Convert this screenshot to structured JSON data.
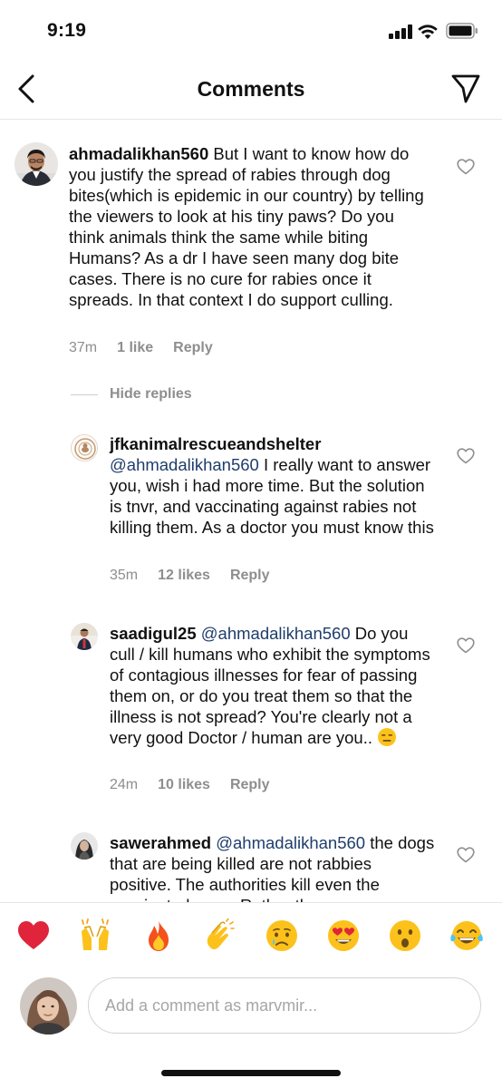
{
  "status_bar": {
    "time": "9:19"
  },
  "header": {
    "title": "Comments"
  },
  "comments": [
    {
      "username": "ahmadalikhan560",
      "mention": "",
      "text": "But I want to know how do you justify the spread of rabies through dog bites(which is epidemic in our country) by telling the viewers to look at his tiny paws? Do you think animals think the same while biting Humans? As a dr I have seen many dog bite cases. There is no cure for rabies once it spreads. In that context I do support culling.",
      "time": "37m",
      "likes": "1 like",
      "reply": "Reply"
    },
    {
      "username": "jfkanimalrescueandshelter",
      "mention": "@ahmadalikhan560",
      "text": "I really want to answer you, wish i had more time. But the solution is tnvr, and vaccinating against rabies not killing them. As a doctor you must know this",
      "time": "35m",
      "likes": "12 likes",
      "reply": "Reply"
    },
    {
      "username": "saadigul25",
      "mention": "@ahmadalikhan560",
      "text": "Do you cull / kill humans who exhibit the symptoms of contagious illnesses for fear of passing them on, or do you treat them so that the illness is not spread? You're clearly not a very good Doctor / human are you..",
      "time": "24m",
      "likes": "10 likes",
      "reply": "Reply"
    },
    {
      "username": "sawerahmed",
      "mention": "@ahmadalikhan560",
      "text": "the dogs that are being killed are not rabbies positive. The authorities kill even the vaccinated ones. Rather than",
      "time": "",
      "likes": "",
      "reply": ""
    }
  ],
  "hide_replies": "Hide replies",
  "emoji_bar": [
    "red-heart-emoji",
    "raising-hands-emoji",
    "fire-emoji",
    "clapping-hands-emoji",
    "crying-face-emoji",
    "heart-eyes-emoji",
    "surprised-face-emoji",
    "tears-of-joy-emoji"
  ],
  "compose": {
    "placeholder": "Add a comment as marvmir..."
  },
  "colors": {
    "mention": "#1e3d6b",
    "muted": "#8e8e8e",
    "heart": "#e0245e"
  }
}
